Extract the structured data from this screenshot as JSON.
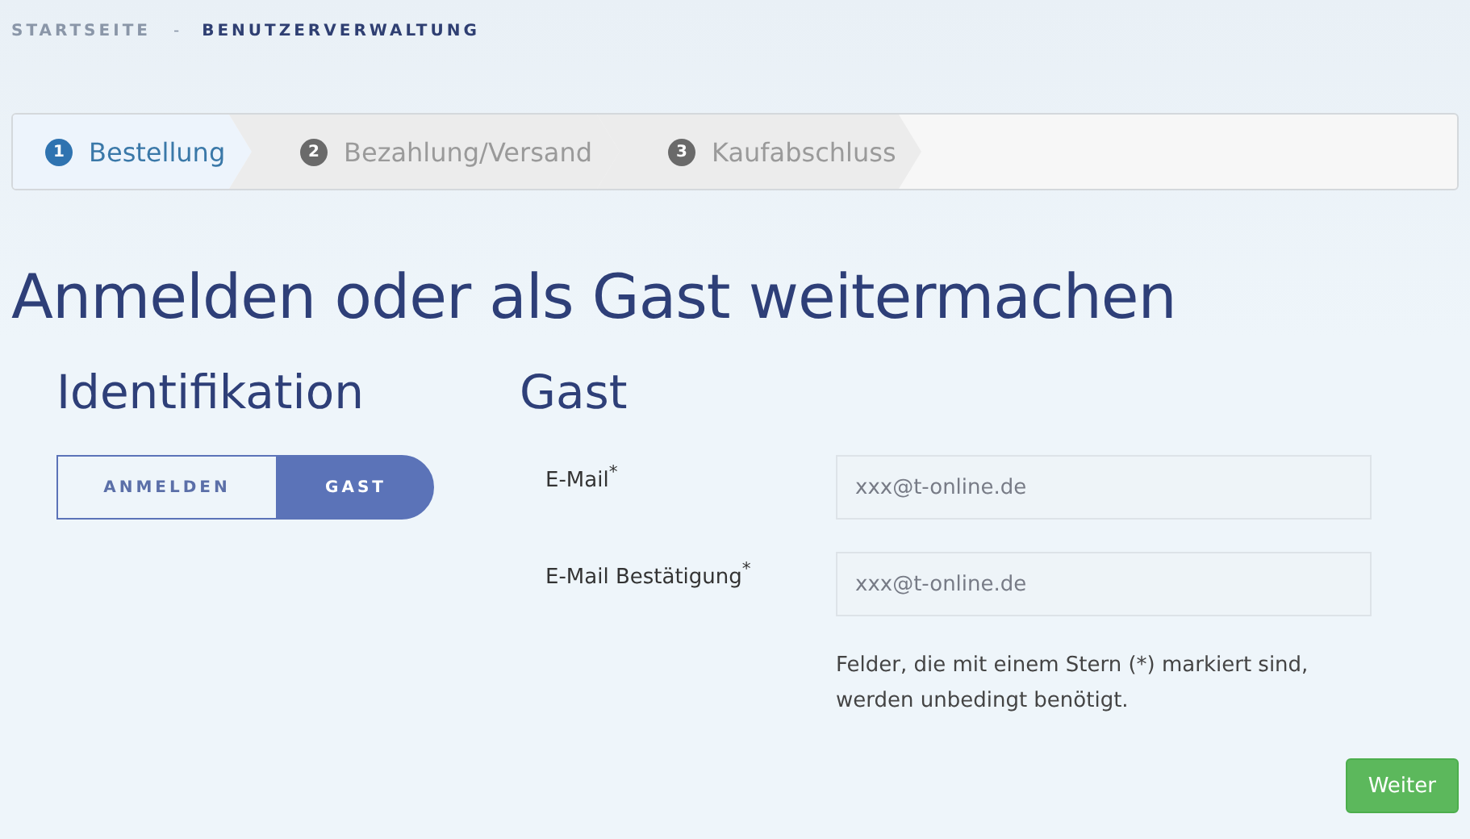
{
  "breadcrumb": [
    {
      "label": "STARTSEITE",
      "selected": false
    },
    {
      "label": "BENUTZERVERWALTUNG",
      "selected": true
    }
  ],
  "breadcrumb_separator": "-",
  "steps": [
    {
      "number": "1",
      "label": "Bestellung",
      "selected": true
    },
    {
      "number": "2",
      "label": "Bezahlung/Versand",
      "selected": false
    },
    {
      "number": "3",
      "label": "Kaufabschluss",
      "selected": false
    }
  ],
  "heading": "Anmelden oder als Gast weitermachen",
  "identification": {
    "title": "Identifikation",
    "options": [
      {
        "label": "ANMELDEN",
        "selected": false
      },
      {
        "label": "GAST",
        "selected": true
      }
    ]
  },
  "guest": {
    "title": "Gast",
    "fields": [
      {
        "label": "E-Mail$^{*}$",
        "value": "xxx@t-online.de"
      },
      {
        "label": "E-Mail Bestätigung$^{*}$",
        "value": "xxx@t-online.de"
      }
    ],
    "note": "Felder, die mit einem Stern (*) markiert sind, werden unbedingt benötigt.",
    "button": "Weiter"
  }
}
